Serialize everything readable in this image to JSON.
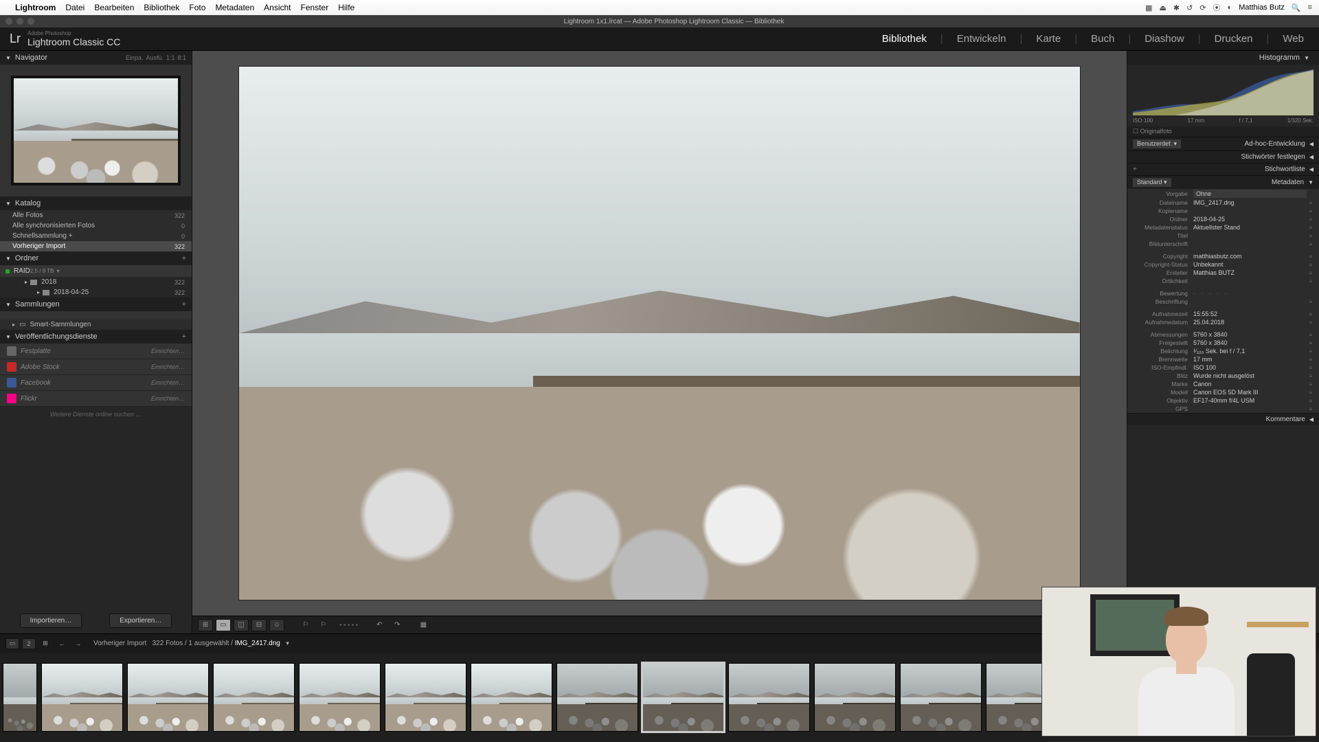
{
  "mac_menu": {
    "app": "Lightroom",
    "items": [
      "Datei",
      "Bearbeiten",
      "Bibliothek",
      "Foto",
      "Metadaten",
      "Ansicht",
      "Fenster",
      "Hilfe"
    ],
    "user": "Matthias Butz"
  },
  "window_title": "Lightroom 1x1.lrcat — Adobe Photoshop Lightroom Classic — Bibliothek",
  "app_header": {
    "brand_small": "Adobe Photoshop",
    "brand": "Lightroom Classic CC",
    "modules": [
      "Bibliothek",
      "Entwickeln",
      "Karte",
      "Buch",
      "Diashow",
      "Drucken",
      "Web"
    ],
    "active_module": "Bibliothek"
  },
  "navigator": {
    "title": "Navigator",
    "fit": "Einpa.",
    "fill": "Ausfü.",
    "one": "1:1",
    "custom": "8:1"
  },
  "catalog": {
    "title": "Katalog",
    "rows": [
      {
        "label": "Alle Fotos",
        "count": "322"
      },
      {
        "label": "Alle synchronisierten Fotos",
        "count": "0"
      },
      {
        "label": "Schnellsammlung  +",
        "count": "0"
      },
      {
        "label": "Vorheriger Import",
        "count": "322",
        "selected": true
      }
    ]
  },
  "folders": {
    "title": "Ordner",
    "volume": {
      "name": "RAID",
      "info": "2,5 / 8 TB"
    },
    "items": [
      {
        "label": "2018",
        "count": "322",
        "depth": 0
      },
      {
        "label": "2018-04-25",
        "count": "322",
        "depth": 1
      }
    ]
  },
  "collections": {
    "title": "Sammlungen",
    "smart": "Smart-Sammlungen"
  },
  "publish": {
    "title": "Veröffentlichungsdienste",
    "services": [
      {
        "name": "Festplatte",
        "color": "#666"
      },
      {
        "name": "Adobe Stock",
        "color": "#c62828"
      },
      {
        "name": "Facebook",
        "color": "#3b5998"
      },
      {
        "name": "Flickr",
        "color": "#ff0084"
      }
    ],
    "setup_label": "Einrichten…",
    "find_more": "Weitere Dienste online suchen …"
  },
  "import_btn": "Importieren…",
  "export_btn": "Exportieren…",
  "histogram": {
    "title": "Histogramm",
    "iso": "ISO 100",
    "focal": "17 mm",
    "aperture": "f / 7,1",
    "shutter": "1/320 Sek.",
    "original": "Originalfoto"
  },
  "right_sections": {
    "user_level": "Benutzerdef.",
    "quick_dev": "Ad-hoc-Entwicklung",
    "keywording": "Stichwörter festlegen",
    "keyword_list": "Stichwortliste",
    "metadata": "Metadaten",
    "comments": "Kommentare"
  },
  "metadata": {
    "preset_label": "Standard",
    "preset_field_label": "Vorgabe",
    "preset_value": "Ohne",
    "rows": [
      {
        "label": "Dateiname",
        "value": "IMG_2417.dng"
      },
      {
        "label": "Kopiename",
        "value": ""
      },
      {
        "label": "Ordner",
        "value": "2018-04-25"
      },
      {
        "label": "Metadatenstatus",
        "value": "Aktuellster Stand"
      },
      {
        "label": "Titel",
        "value": ""
      },
      {
        "label": "Bildunterschrift",
        "value": ""
      }
    ],
    "rows2": [
      {
        "label": "Copyright",
        "value": "matthiasbutz.com"
      },
      {
        "label": "Copyright-Status",
        "value": "Unbekannt"
      },
      {
        "label": "Ersteller",
        "value": "Matthias BUTZ"
      },
      {
        "label": "Örtlichkeit",
        "value": ""
      }
    ],
    "rating_label": "Bewertung",
    "label_label": "Beschriftung",
    "rows3": [
      {
        "label": "Aufnahmezeit",
        "value": "15:55:52"
      },
      {
        "label": "Aufnahmedatum",
        "value": "25.04.2018"
      }
    ],
    "rows4": [
      {
        "label": "Abmessungen",
        "value": "5760 x 3840"
      },
      {
        "label": "Freigestellt",
        "value": "5760 x 3840"
      },
      {
        "label": "Belichtung",
        "value": "¹⁄₃₂₀ Sek. bei f / 7,1"
      },
      {
        "label": "Brennweite",
        "value": "17 mm"
      },
      {
        "label": "ISO-Empfindl.",
        "value": "ISO 100"
      },
      {
        "label": "Blitz",
        "value": "Wurde nicht ausgelöst"
      },
      {
        "label": "Marke",
        "value": "Canon"
      },
      {
        "label": "Modell",
        "value": "Canon EOS 5D Mark III"
      },
      {
        "label": "Objektiv",
        "value": "EF17-40mm f/4L USM"
      },
      {
        "label": "GPS",
        "value": ""
      }
    ]
  },
  "filmstrip_bar": {
    "source": "Vorheriger Import",
    "count_text": "322 Fotos / 1 ausgewählt /",
    "filename": "IMG_2417.dng"
  },
  "thumbnails": [
    {
      "variant": "light"
    },
    {
      "variant": "light"
    },
    {
      "variant": "light"
    },
    {
      "variant": "light"
    },
    {
      "variant": "light"
    },
    {
      "variant": "light"
    },
    {
      "variant": "dark"
    },
    {
      "variant": "dark",
      "selected": true
    },
    {
      "variant": "dark"
    },
    {
      "variant": "dark"
    },
    {
      "variant": "dark"
    },
    {
      "variant": "dark"
    },
    {
      "variant": "dark"
    }
  ]
}
